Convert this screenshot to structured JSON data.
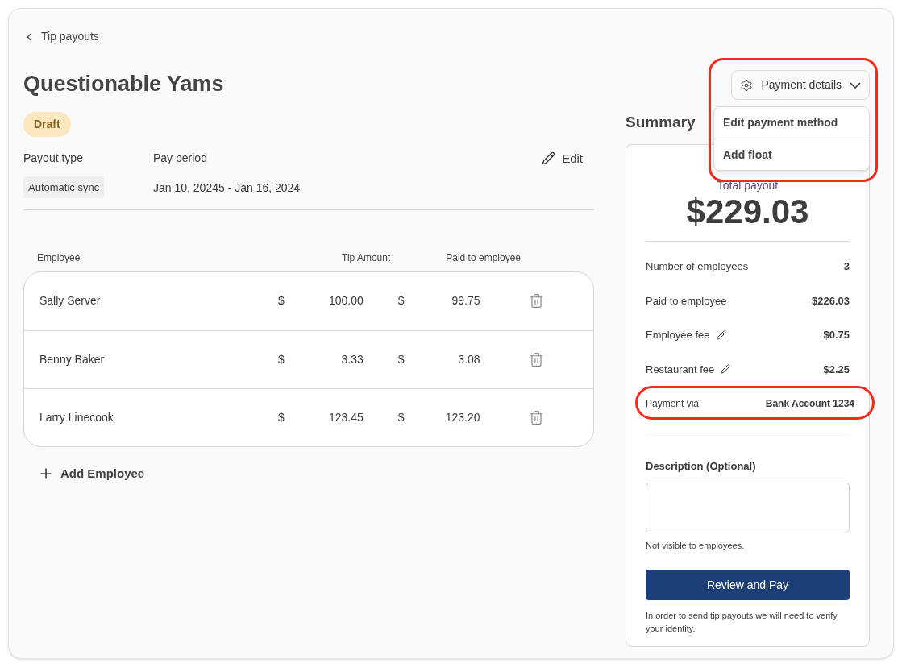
{
  "breadcrumb": {
    "label": "Tip payouts"
  },
  "title": "Questionable Yams",
  "status": {
    "label": "Draft"
  },
  "details": {
    "payout_type": {
      "label": "Payout type",
      "value": "Automatic sync"
    },
    "pay_period": {
      "label": "Pay period",
      "value": "Jan 10, 20245 - Jan 16, 2024"
    },
    "edit_button": "Edit"
  },
  "table": {
    "columns": [
      "Employee",
      "Tip Amount",
      "Paid to employee"
    ],
    "rows": [
      {
        "name": "Sally Server",
        "tip_currency": "$",
        "tip": "100.00",
        "paid_currency": "$",
        "paid": "99.75"
      },
      {
        "name": "Benny Baker",
        "tip_currency": "$",
        "tip": "3.33",
        "paid_currency": "$",
        "paid": "3.08"
      },
      {
        "name": "Larry Linecook",
        "tip_currency": "$",
        "tip": "123.45",
        "paid_currency": "$",
        "paid": "123.20"
      }
    ]
  },
  "add_employee": "Add Employee",
  "payment_menu": {
    "button": "Payment details",
    "expanded": true,
    "items": [
      "Edit payment method",
      "Add float"
    ]
  },
  "summary": {
    "heading": "Summary",
    "total_label": "Total payout",
    "total": "$229.03",
    "rows": [
      {
        "kind": "plain",
        "label": "Number of employees",
        "value": "3"
      },
      {
        "kind": "plain",
        "label": "Paid to employee",
        "value": "$226.03"
      },
      {
        "kind": "editable",
        "label": "Employee fee",
        "value": "$0.75"
      },
      {
        "kind": "editable",
        "label": "Restaurant fee",
        "value": "$2.25"
      },
      {
        "kind": "payment",
        "label": "Payment via",
        "value": "Bank Account 1234"
      }
    ],
    "description": {
      "label": "Description (Optional)",
      "hint": "Not visible to employees."
    },
    "pay_button": "Review and Pay",
    "note": "In order to send tip payouts we will need to verify your identity."
  }
}
